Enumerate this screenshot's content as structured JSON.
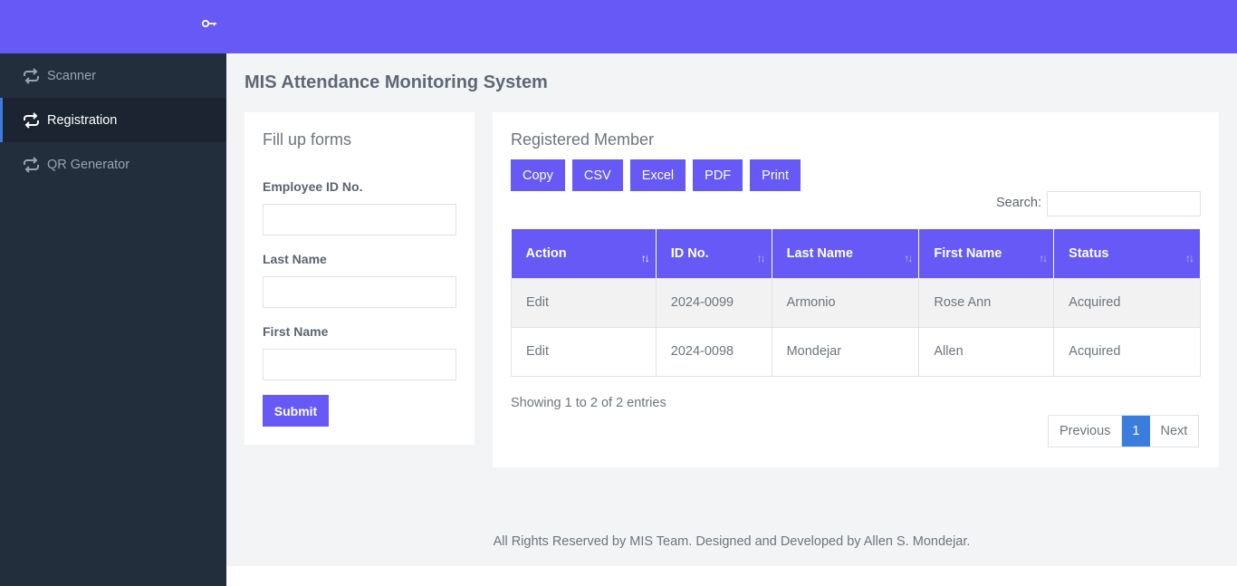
{
  "sidebar": {
    "items": [
      {
        "label": "Scanner"
      },
      {
        "label": "Registration"
      },
      {
        "label": "QR Generator"
      }
    ]
  },
  "page": {
    "title": "MIS Attendance Monitoring System"
  },
  "form": {
    "title": "Fill up forms",
    "employee_id_label": "Employee ID No.",
    "employee_id_value": "",
    "last_name_label": "Last Name",
    "last_name_value": "",
    "first_name_label": "First Name",
    "first_name_value": "",
    "submit_label": "Submit"
  },
  "table_card": {
    "title": "Registered Member",
    "buttons": [
      "Copy",
      "CSV",
      "Excel",
      "PDF",
      "Print"
    ],
    "search_label": "Search:",
    "search_value": "",
    "columns": [
      "Action",
      "ID No.",
      "Last Name",
      "First Name",
      "Status"
    ],
    "rows": [
      [
        "Edit",
        "2024-0099",
        "Armonio",
        "Rose Ann",
        "Acquired"
      ],
      [
        "Edit",
        "2024-0098",
        "Mondejar",
        "Allen",
        "Acquired"
      ]
    ],
    "info": "Showing 1 to 2 of 2 entries",
    "pager": {
      "previous": "Previous",
      "current": "1",
      "next": "Next"
    }
  },
  "footer": {
    "text": "All Rights Reserved by MIS Team. Designed and Developed by Allen S. Mondejar."
  },
  "colors": {
    "accent": "#6759f5",
    "sidebar": "#222e3c",
    "pager_active": "#3b7ddd"
  }
}
